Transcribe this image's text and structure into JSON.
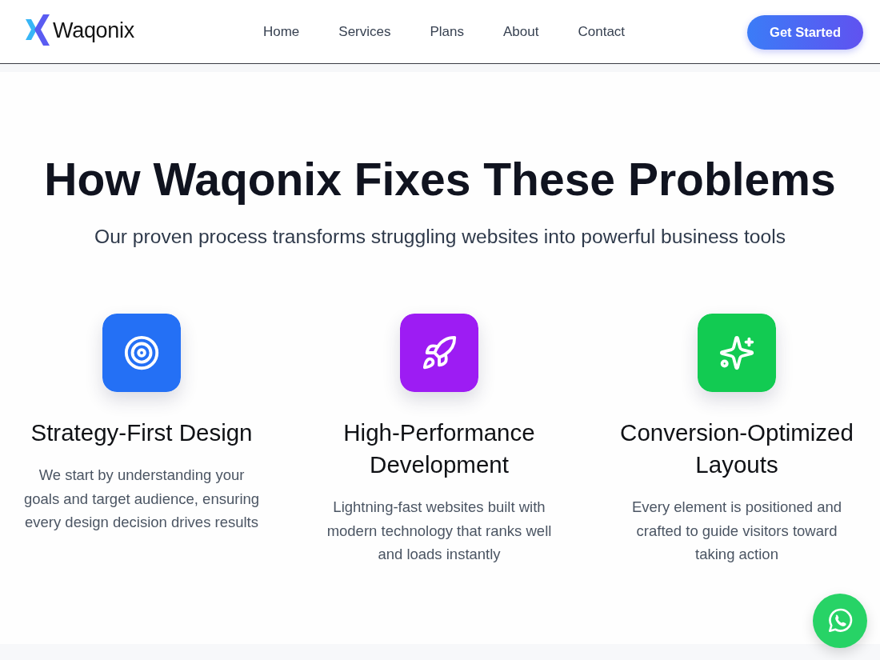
{
  "header": {
    "logo": {
      "text": "Waqonix"
    },
    "nav": [
      {
        "label": "Home"
      },
      {
        "label": "Services"
      },
      {
        "label": "Plans"
      },
      {
        "label": "About"
      },
      {
        "label": "Contact"
      }
    ],
    "cta": "Get Started"
  },
  "hero": {
    "title": "How Waqonix Fixes These Problems",
    "subtitle": "Our proven process transforms struggling websites into powerful business tools"
  },
  "features": [
    {
      "color": "#2470f5",
      "title": "Strategy-First Design",
      "description": "We start by understanding your goals and target audience, ensuring every design decision drives results"
    },
    {
      "color": "#9d1cf3",
      "title": "High-Performance Development",
      "description": "Lightning-fast websites built with modern technology that ranks well and loads instantly"
    },
    {
      "color": "#12cb52",
      "title": "Conversion-Optimized Layouts",
      "description": "Every element is positioned and crafted to guide visitors toward taking action"
    }
  ]
}
